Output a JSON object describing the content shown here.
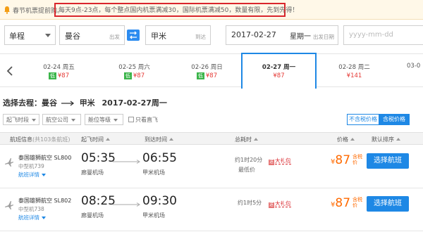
{
  "notice": {
    "lead": "春节机票提前购。",
    "promo": "每天9点-23点，每个整点国内机票满减30，国际机票满减50，数量有限，先到先得！"
  },
  "search": {
    "trip_type": "单程",
    "from_city": "曼谷",
    "from_hint": "出发",
    "to_city": "甲米",
    "to_hint": "到达",
    "depart_date": "2017-02-27",
    "depart_weekday": "星期一",
    "depart_hint": "出发日期",
    "return_placeholder": "yyyy-mm-dd"
  },
  "dates": [
    {
      "label": "02-24 周五",
      "price": "¥87",
      "low": "低",
      "selected": false
    },
    {
      "label": "02-25 周六",
      "price": "¥87",
      "low": "低",
      "selected": false
    },
    {
      "label": "02-26 周日",
      "price": "¥87",
      "low": "低",
      "selected": false
    },
    {
      "label": "02-27 周一",
      "price": "¥87",
      "low": "",
      "selected": true
    },
    {
      "label": "02-28 周二",
      "price": "¥141",
      "low": "",
      "selected": false
    },
    {
      "label": "03-0",
      "price": "",
      "low": "",
      "selected": false
    }
  ],
  "route": {
    "prefix": "选择去程：曼谷",
    "dest": "甲米",
    "date": "2017-02-27周一"
  },
  "filters": {
    "time": "起飞时段",
    "airline": "航空公司",
    "cabin": "舱位等级",
    "direct": "只看直飞",
    "tax_exclusive": "不含税价格",
    "tax_inclusive": "含税价格"
  },
  "columns": {
    "flight_info": "航班信息",
    "flight_count": "(共103条航班)",
    "depart_time": "起飞时间",
    "arrive_time": "到达时间",
    "duration": "总耗时",
    "price": "价格",
    "sort": "默认排序"
  },
  "flights": [
    {
      "airline": "泰国雄狮航空 SL800",
      "model": "中型机739",
      "detail": "航班详情",
      "dep_time": "05:35",
      "dep_airport": "廊曼机场",
      "arr_time": "06:55",
      "arr_airport": "甲米机场",
      "duration": "约1时20分",
      "tag": "最低价",
      "gift_prefix": "送",
      "gift": "大礼包",
      "currency": "¥",
      "price": "87",
      "tax_inc": "含税价",
      "button": "选择航班"
    },
    {
      "airline": "泰国雄狮航空 SL802",
      "model": "中型机738",
      "detail": "航班详情",
      "dep_time": "08:25",
      "dep_airport": "廊曼机场",
      "arr_time": "09:30",
      "arr_airport": "甲米机场",
      "duration": "约1时5分",
      "tag": "",
      "gift_prefix": "送",
      "gift": "大礼包",
      "currency": "¥",
      "price": "87",
      "tax_inc": "含税价",
      "button": "选择航班"
    }
  ]
}
